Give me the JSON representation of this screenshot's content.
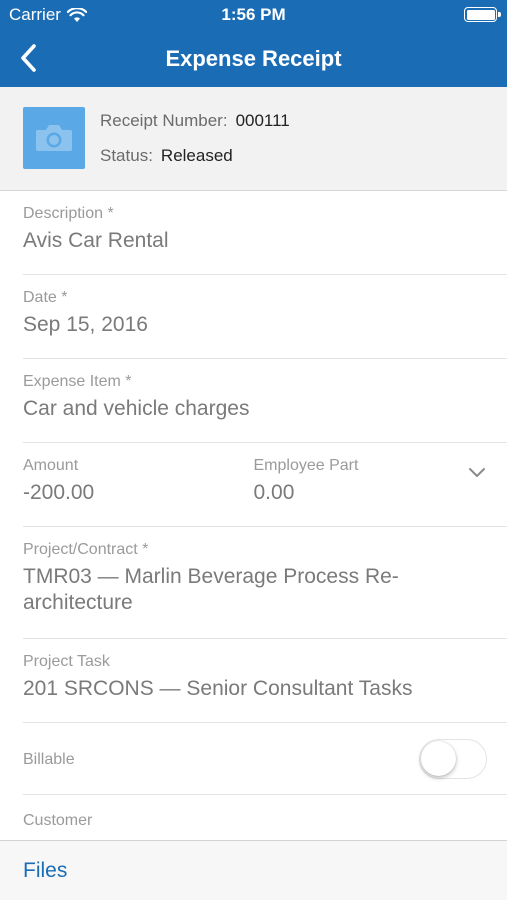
{
  "status_bar": {
    "carrier": "Carrier",
    "time": "1:56 PM"
  },
  "nav": {
    "title": "Expense Receipt",
    "back_icon": "chevron-left-icon"
  },
  "receipt": {
    "number_label": "Receipt Number:",
    "number_value": "000111",
    "status_label": "Status:",
    "status_value": "Released",
    "thumbnail_icon": "camera-icon"
  },
  "fields": {
    "description": {
      "label": "Description *",
      "value": "Avis Car Rental"
    },
    "date": {
      "label": "Date *",
      "value": "Sep 15, 2016"
    },
    "expense_item": {
      "label": "Expense Item *",
      "value": "Car and vehicle charges"
    },
    "amount": {
      "label": "Amount",
      "value": "-200.00"
    },
    "employee_part": {
      "label": "Employee Part",
      "value": "0.00"
    },
    "project": {
      "label": "Project/Contract *",
      "value": "TMR03 — Marlin Beverage Process Re-architecture"
    },
    "project_task": {
      "label": "Project Task",
      "value": "201 SRCONS — Senior Consultant Tasks"
    },
    "billable": {
      "label": "Billable",
      "on": false
    },
    "customer": {
      "label": "Customer"
    }
  },
  "bottom": {
    "files_label": "Files"
  },
  "colors": {
    "accent": "#1a6db5",
    "thumbnail": "#5aa9e6"
  }
}
